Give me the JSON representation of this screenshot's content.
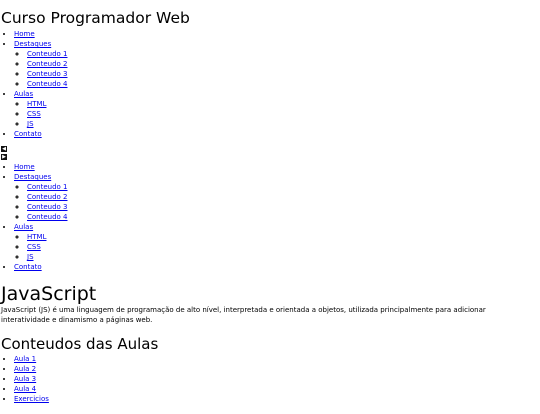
{
  "site": {
    "title": "Curso Programador Web"
  },
  "nav_top": {
    "home": "Home",
    "destaques": "Destaques",
    "destaques_items": [
      "Conteudo 1",
      "Conteudo 2",
      "Conteudo 3",
      "Conteudo 4"
    ],
    "aulas": "Aulas",
    "aulas_items": [
      "HTML",
      "CSS",
      "JS"
    ],
    "contato": "Contato"
  },
  "controls": {
    "prev_icon": "◀",
    "next_icon": "▶"
  },
  "nav_bottom": {
    "home": "Home",
    "destaques": "Destaques",
    "destaques_items": [
      "Conteudo 1",
      "Conteudo 2",
      "Conteudo 3",
      "Conteudo 4"
    ],
    "aulas": "Aulas",
    "aulas_items": [
      "HTML",
      "CSS",
      "JS"
    ],
    "contato": "Contato"
  },
  "article": {
    "title": "JavaScript",
    "text": "JavaScript (JS) é uma linguagem de programação de alto nível, interpretada e orientada a objetos, utilizada principalmente para adicionar interatividade e dinamismo a páginas web."
  },
  "contents": {
    "title": "Conteudos das Aulas",
    "items": [
      "Aula 1",
      "Aula 2",
      "Aula 3",
      "Aula 4",
      "Exercicios"
    ]
  }
}
